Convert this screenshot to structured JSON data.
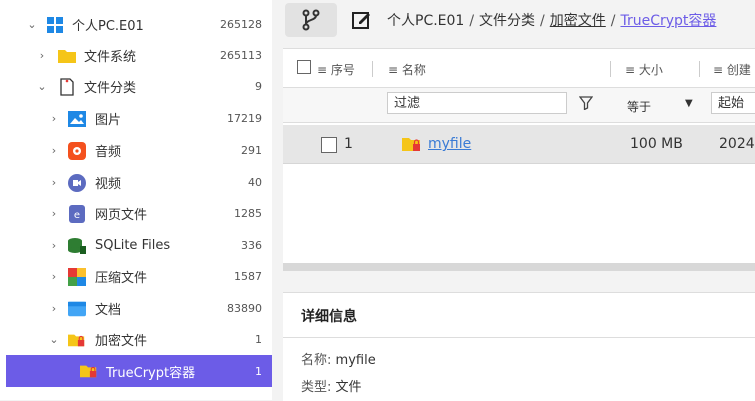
{
  "sidebar": {
    "items": [
      {
        "label": "个人PC.E01",
        "count": "265128",
        "expanded": true,
        "icon": "windows-icon"
      },
      {
        "label": "文件系统",
        "count": "265113",
        "expanded": false,
        "icon": "folder-icon"
      },
      {
        "label": "文件分类",
        "count": "9",
        "expanded": true,
        "icon": "document-icon"
      },
      {
        "label": "图片",
        "count": "17219",
        "expanded": false,
        "icon": "image-icon"
      },
      {
        "label": "音频",
        "count": "291",
        "expanded": false,
        "icon": "audio-icon"
      },
      {
        "label": "视频",
        "count": "40",
        "expanded": false,
        "icon": "video-icon"
      },
      {
        "label": "网页文件",
        "count": "1285",
        "expanded": false,
        "icon": "web-icon"
      },
      {
        "label": "SQLite Files",
        "count": "336",
        "expanded": false,
        "icon": "database-icon"
      },
      {
        "label": "压缩文件",
        "count": "1587",
        "expanded": false,
        "icon": "archive-icon"
      },
      {
        "label": "文档",
        "count": "83890",
        "expanded": false,
        "icon": "doc-icon"
      },
      {
        "label": "加密文件",
        "count": "1",
        "expanded": true,
        "icon": "locked-folder-icon"
      },
      {
        "label": "TrueCrypt容器",
        "count": "1",
        "selected": true,
        "icon": "locked-folder-icon"
      }
    ]
  },
  "breadcrumb": {
    "root": "个人PC.E01",
    "cat": "文件分类",
    "sub": "加密文件",
    "current": "TrueCrypt容器"
  },
  "table": {
    "columns": {
      "index": "序号",
      "name": "名称",
      "size": "大小",
      "created": "创建"
    },
    "filter": {
      "placeholder": "过滤",
      "operator": "等于",
      "start": "起始"
    },
    "rows": [
      {
        "index": "1",
        "name": "myfile",
        "size": "100 MB",
        "date": "2024"
      }
    ]
  },
  "details": {
    "title": "详细信息",
    "name_label": "名称:",
    "name_value": "myfile",
    "type_label": "类型:",
    "type_value": "文件"
  },
  "colors": {
    "accent": "#6c5ce7",
    "link": "#3a7bd5"
  }
}
